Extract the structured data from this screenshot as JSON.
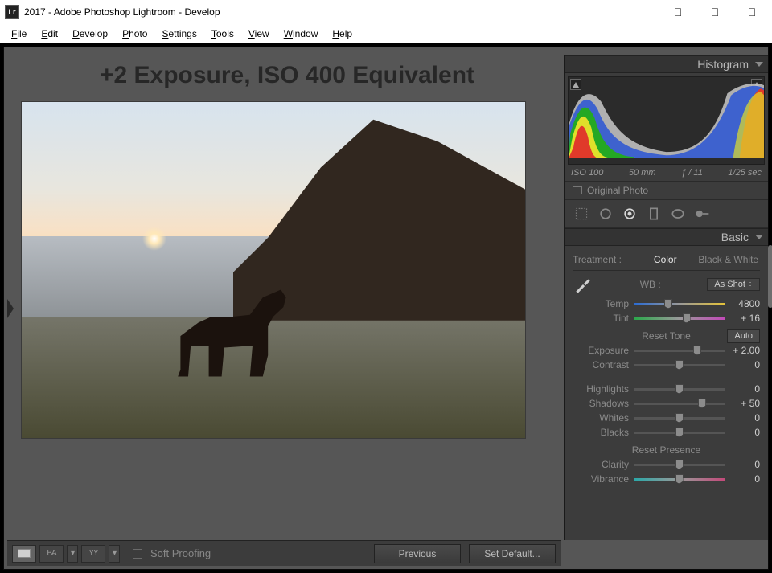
{
  "window": {
    "title": "2017 - Adobe Photoshop Lightroom - Develop"
  },
  "menu": [
    "File",
    "Edit",
    "Develop",
    "Photo",
    "Settings",
    "Tools",
    "View",
    "Window",
    "Help"
  ],
  "overlay": {
    "title": "+2 Exposure, ISO 400 Equivalent"
  },
  "toolbar": {
    "soft_proofing": "Soft Proofing",
    "view_ba": "BA",
    "view_yy": "YY",
    "previous": "Previous",
    "set_default": "Set Default..."
  },
  "panel": {
    "histogram_label": "Histogram",
    "exif": {
      "iso": "ISO 100",
      "focal": "50 mm",
      "aperture": "ƒ / 11",
      "shutter": "1/25 sec"
    },
    "original_photo": "Original Photo",
    "basic_label": "Basic",
    "treatment_label": "Treatment :",
    "treatment_color": "Color",
    "treatment_bw": "Black & White",
    "wb_label": "WB :",
    "wb_value": "As Shot",
    "reset_tone": "Reset Tone",
    "auto": "Auto",
    "reset_presence": "Reset Presence",
    "sliders": {
      "temp": {
        "label": "Temp",
        "value": "4800",
        "pos": 38
      },
      "tint": {
        "label": "Tint",
        "value": "+ 16",
        "pos": 58
      },
      "exposure": {
        "label": "Exposure",
        "value": "+ 2.00",
        "pos": 70
      },
      "contrast": {
        "label": "Contrast",
        "value": "0",
        "pos": 50
      },
      "highlights": {
        "label": "Highlights",
        "value": "0",
        "pos": 50
      },
      "shadows": {
        "label": "Shadows",
        "value": "+ 50",
        "pos": 75
      },
      "whites": {
        "label": "Whites",
        "value": "0",
        "pos": 50
      },
      "blacks": {
        "label": "Blacks",
        "value": "0",
        "pos": 50
      },
      "clarity": {
        "label": "Clarity",
        "value": "0",
        "pos": 50
      },
      "vibrance": {
        "label": "Vibrance",
        "value": "0",
        "pos": 50
      }
    }
  }
}
